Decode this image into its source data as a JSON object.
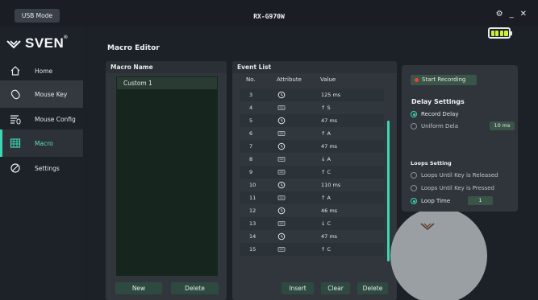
{
  "topbar": {
    "usb_mode": "USB Mode",
    "title": "RX-G970W",
    "gear": "⚙",
    "minimize": "_",
    "close": "✕"
  },
  "logo": {
    "text": "SVEN",
    "reg": "®"
  },
  "sidebar": {
    "items": [
      {
        "label": "Home",
        "icon": "home-icon"
      },
      {
        "label": "Mouse Key",
        "icon": "mouse-key-icon"
      },
      {
        "label": "Mouse Config",
        "icon": "mouse-config-icon"
      },
      {
        "label": "Macro",
        "icon": "macro-icon"
      },
      {
        "label": "Settings",
        "icon": "settings-icon"
      }
    ]
  },
  "main": {
    "title": "Macro Editor"
  },
  "macro_panel": {
    "title": "Macro Name",
    "items": [
      "Custom 1"
    ],
    "new_label": "New",
    "delete_label": "Delete"
  },
  "event_panel": {
    "title": "Event List",
    "columns": [
      "No.",
      "Attribute",
      "Value"
    ],
    "rows": [
      {
        "no": "3",
        "attr": "clock-icon",
        "value": "125 ms"
      },
      {
        "no": "4",
        "attr": "keyboard-icon",
        "value": "↑ S"
      },
      {
        "no": "5",
        "attr": "clock-icon",
        "value": "47 ms"
      },
      {
        "no": "6",
        "attr": "keyboard-icon",
        "value": "↑ A"
      },
      {
        "no": "7",
        "attr": "clock-icon",
        "value": "47 ms"
      },
      {
        "no": "8",
        "attr": "keyboard-icon",
        "value": "↓ A"
      },
      {
        "no": "9",
        "attr": "keyboard-icon",
        "value": "↑ C"
      },
      {
        "no": "10",
        "attr": "clock-icon",
        "value": "110 ms"
      },
      {
        "no": "11",
        "attr": "keyboard-icon",
        "value": "↑ A"
      },
      {
        "no": "12",
        "attr": "clock-icon",
        "value": "46 ms"
      },
      {
        "no": "13",
        "attr": "keyboard-icon",
        "value": "↓ C"
      },
      {
        "no": "14",
        "attr": "clock-icon",
        "value": "47 ms"
      },
      {
        "no": "15",
        "attr": "keyboard-icon",
        "value": "↑ C"
      }
    ],
    "insert_label": "Insert",
    "clear_label": "Clear",
    "delete_label": "Delete"
  },
  "recording": {
    "start_label": "Start Recording",
    "delay_title": "Delay Settings",
    "record_delay": "Record Delay",
    "uniform_delay": "Uniform Dela",
    "uniform_value": "10  ms",
    "loops_title": "Loops Setting",
    "loop_released": "Loops Until Key is Released",
    "loop_pressed": "Loops Until Key is Pressed",
    "loop_time": "Loop Time",
    "loop_time_value": "1"
  },
  "colors": {
    "accent": "#3fd6b4",
    "record": "#ff3b30",
    "battery": "#c8f23a"
  }
}
